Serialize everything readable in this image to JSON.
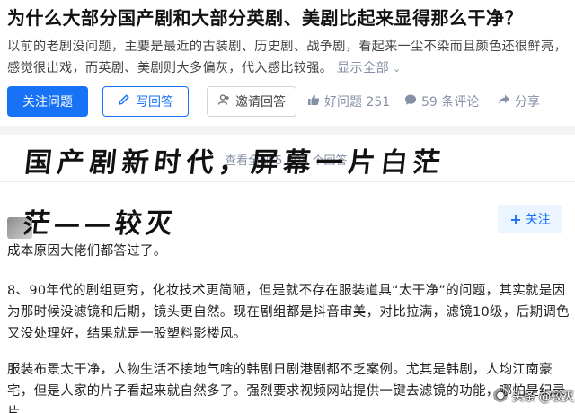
{
  "question": {
    "title": "为什么大部分国产剧和大部分英剧、美剧比起来显得那么干净？",
    "description": "以前的老剧没问题，主要是最近的古装剧、历史剧、战争剧，看起来一尘不染而且颜色还很鲜亮，感觉很出戏，而英剧、美剧则大多偏灰，代入感比较强。",
    "show_all": "显示全部"
  },
  "actions": {
    "follow_question": "关注问题",
    "write_answer": "写回答",
    "invite_answer": "邀请回答",
    "good_question": "好问题 251",
    "comments": "59 条评论",
    "share": "分享"
  },
  "banner": {
    "view_all": "查看全部 5,004 个回答",
    "overlay_text": "国产剧新时代，屏幕一片白茫"
  },
  "answer": {
    "overlay_text": "茫——较灭",
    "follow_button": "关注",
    "paragraphs": [
      "成本原因大佬们都答过了。",
      "8、90年代的剧组更穷，化妆技术更简陋，但是就不存在服装道具“太干净”的问题，其实就是因为那时候没滤镜和后期，镜头更自然。现在剧组都是抖音审美，对比拉满，滤镜10级，后期调色又没处理好，结果就是一股塑料影楼风。",
      "服装布景太干净，人物生活不接地气啥的韩剧日剧港剧都不乏案例。尤其是韩剧，人均江南豪宅，但是人家的片子看起来就自然多了。强烈要求视频网站提供一键去滤镜的功能，哪怕是纪录片"
    ]
  },
  "watermark": {
    "text": "头条 @较灭"
  },
  "colors": {
    "primary": "#1772f6",
    "meta_gray": "#8590a6",
    "follow_bg": "#ebf5ff"
  }
}
